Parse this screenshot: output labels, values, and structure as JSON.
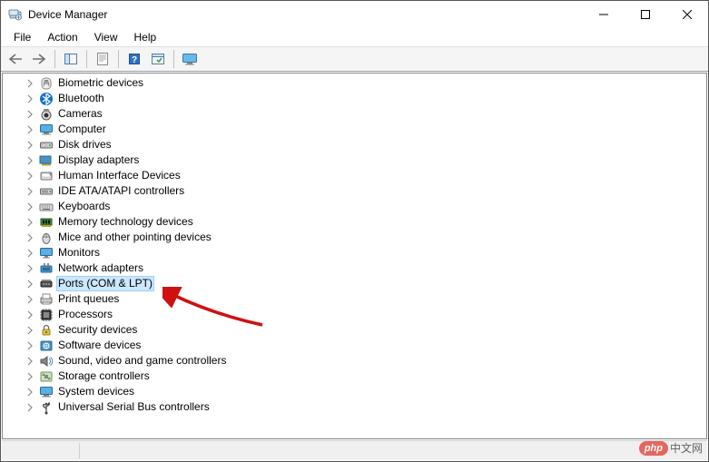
{
  "window": {
    "title": "Device Manager"
  },
  "menu": {
    "file": "File",
    "action": "Action",
    "view": "View",
    "help": "Help"
  },
  "tree": {
    "items": [
      {
        "id": "biometric",
        "label": "Biometric devices"
      },
      {
        "id": "bluetooth",
        "label": "Bluetooth"
      },
      {
        "id": "cameras",
        "label": "Cameras"
      },
      {
        "id": "computer",
        "label": "Computer"
      },
      {
        "id": "disk-drives",
        "label": "Disk drives"
      },
      {
        "id": "display-adapters",
        "label": "Display adapters"
      },
      {
        "id": "hid",
        "label": "Human Interface Devices"
      },
      {
        "id": "ide",
        "label": "IDE ATA/ATAPI controllers"
      },
      {
        "id": "keyboards",
        "label": "Keyboards"
      },
      {
        "id": "memory-tech",
        "label": "Memory technology devices"
      },
      {
        "id": "mice",
        "label": "Mice and other pointing devices"
      },
      {
        "id": "monitors",
        "label": "Monitors"
      },
      {
        "id": "network",
        "label": "Network adapters"
      },
      {
        "id": "ports",
        "label": "Ports (COM & LPT)",
        "selected": true
      },
      {
        "id": "print-queues",
        "label": "Print queues"
      },
      {
        "id": "processors",
        "label": "Processors"
      },
      {
        "id": "security",
        "label": "Security devices"
      },
      {
        "id": "software",
        "label": "Software devices"
      },
      {
        "id": "sound",
        "label": "Sound, video and game controllers"
      },
      {
        "id": "storage",
        "label": "Storage controllers"
      },
      {
        "id": "system",
        "label": "System devices"
      },
      {
        "id": "usb",
        "label": "Universal Serial Bus controllers"
      }
    ]
  },
  "watermark": {
    "logo": "php",
    "text": "中文网"
  }
}
